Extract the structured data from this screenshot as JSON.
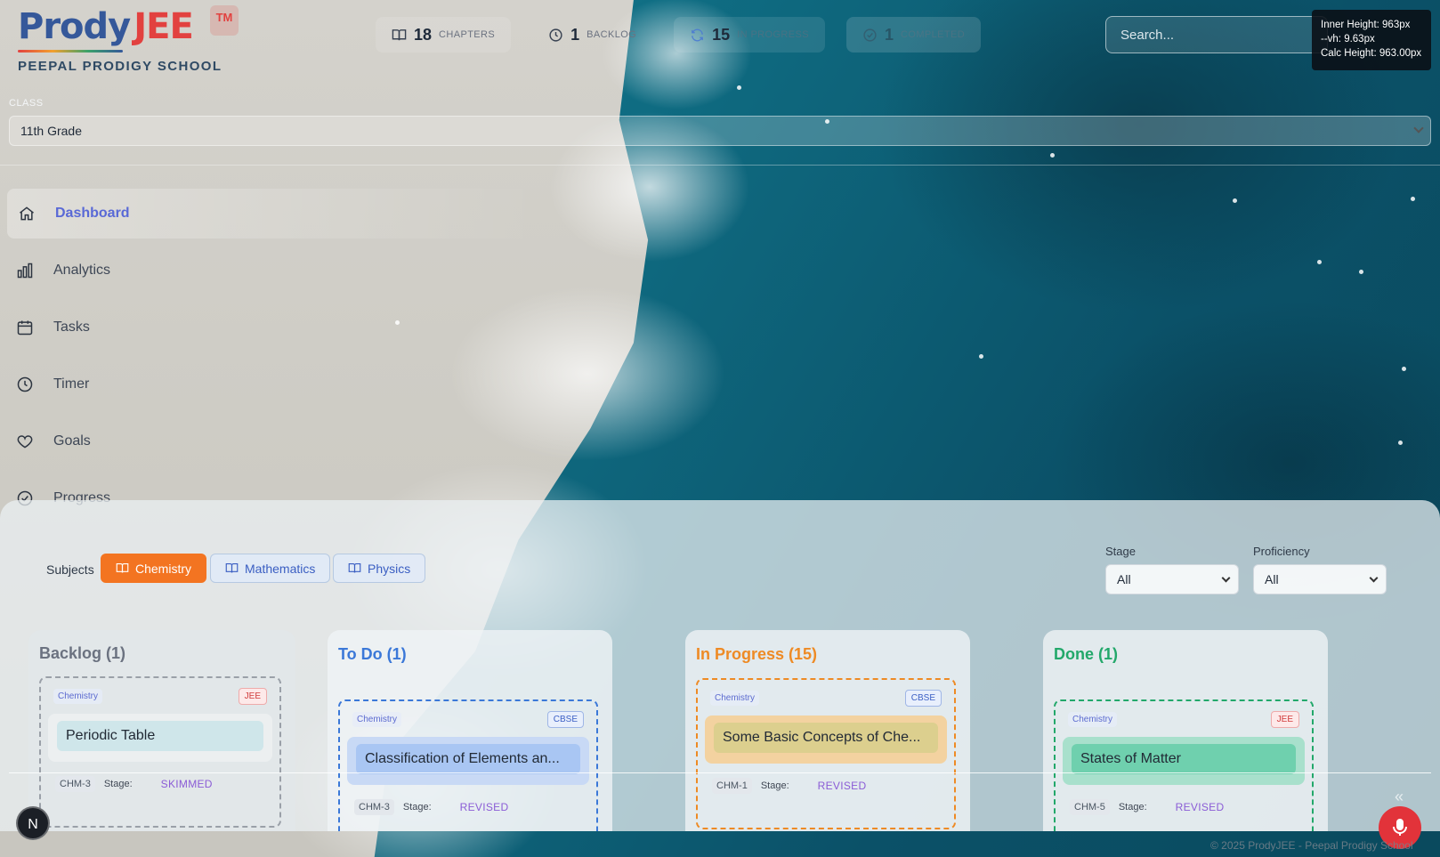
{
  "brand": {
    "name_part1": "Prody",
    "name_part2": "JEE",
    "tm": "TM",
    "school": "PEEPAL PRODIGY SCHOOL",
    "colors": {
      "blue": "#35589a",
      "red": "#e2413f"
    }
  },
  "stats": [
    {
      "icon": "book-icon",
      "value": "18",
      "label": "CHAPTERS"
    },
    {
      "icon": "clock-icon",
      "value": "1",
      "label": "BACKLOG"
    },
    {
      "icon": "refresh-icon",
      "value": "15",
      "label": "IN PROGRESS"
    },
    {
      "icon": "check-circle-icon",
      "value": "1",
      "label": "COMPLETED"
    }
  ],
  "search": {
    "placeholder": "Search..."
  },
  "debug": {
    "line1": "Inner Height: 963px",
    "line2": "--vh: 9.63px",
    "line3": "Calc Height: 963.00px"
  },
  "class_select": {
    "label": "CLASS",
    "value": "11th Grade"
  },
  "nav": [
    {
      "label": "Dashboard",
      "icon": "home-icon",
      "active": true
    },
    {
      "label": "Analytics",
      "icon": "bar-chart-icon"
    },
    {
      "label": "Tasks",
      "icon": "calendar-icon"
    },
    {
      "label": "Timer",
      "icon": "clock-icon"
    },
    {
      "label": "Goals",
      "icon": "heart-icon"
    },
    {
      "label": "Progress",
      "icon": "check-circle-icon"
    }
  ],
  "subjects": {
    "label": "Subjects",
    "items": [
      "Chemistry",
      "Mathematics",
      "Physics"
    ],
    "active": "Chemistry",
    "active_color": "#f37421"
  },
  "filters": {
    "stage_label": "Stage",
    "stage_value": "All",
    "proficiency_label": "Proficiency",
    "proficiency_value": "All"
  },
  "columns": [
    {
      "title": "Backlog (1)",
      "color": "#6b7280",
      "card": {
        "subject": "Chemistry",
        "board": "JEE",
        "title": "Periodic Table",
        "code": "CHM-3",
        "stage_label": "Stage:",
        "stage": "SKIMMED"
      }
    },
    {
      "title": "To Do (1)",
      "color": "#3b78d8",
      "card": {
        "subject": "Chemistry",
        "board": "CBSE",
        "title": "Classification of Elements an...",
        "code": "CHM-3",
        "stage_label": "Stage:",
        "stage": "REVISED"
      }
    },
    {
      "title": "In Progress (15)",
      "color": "#ee8a24",
      "card": {
        "subject": "Chemistry",
        "board": "CBSE",
        "title": "Some Basic Concepts of Che...",
        "code": "CHM-1",
        "stage_label": "Stage:",
        "stage": "REVISED"
      }
    },
    {
      "title": "Done (1)",
      "color": "#22a86a",
      "card": {
        "subject": "Chemistry",
        "board": "JEE",
        "title": "States of Matter",
        "code": "CHM-5",
        "stage_label": "Stage:",
        "stage": "REVISED"
      }
    }
  ],
  "avatar": "N",
  "footer": "© 2025 ProdyJEE - Peepal Prodigy School"
}
